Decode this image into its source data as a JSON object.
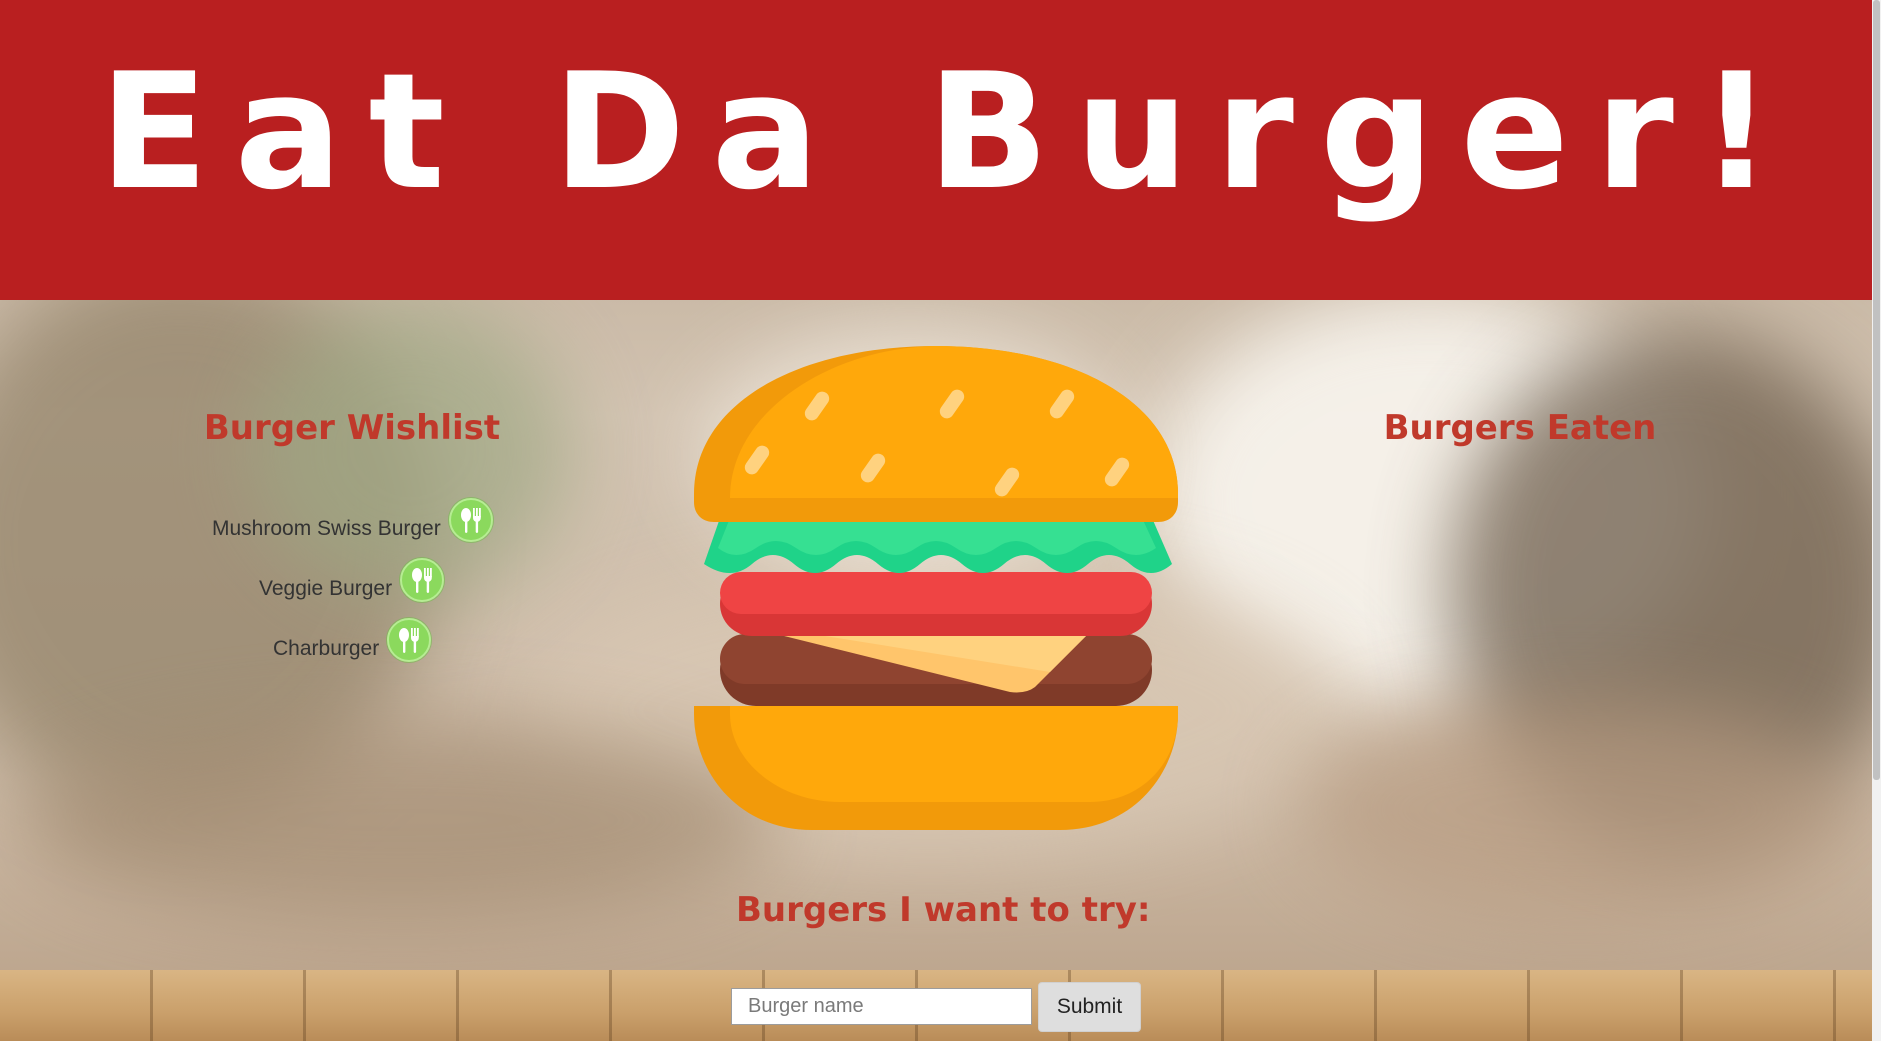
{
  "header": {
    "title": "Eat Da Burger!"
  },
  "wishlist": {
    "heading": "Burger Wishlist",
    "items": [
      {
        "name": "Mushroom Swiss Burger",
        "action_icon": "fork-knife-icon"
      },
      {
        "name": "Veggie Burger",
        "action_icon": "fork-knife-icon"
      },
      {
        "name": "Charburger",
        "action_icon": "fork-knife-icon"
      }
    ]
  },
  "eaten": {
    "heading": "Burgers Eaten",
    "items": []
  },
  "illustration": {
    "icon": "burger-icon"
  },
  "form": {
    "heading": "Burgers I want to try:",
    "input_placeholder": "Burger name",
    "input_value": "",
    "submit_label": "Submit"
  },
  "colors": {
    "header_bg": "#b91f20",
    "heading_text": "#c0392b",
    "devour_button": "#8bd95d",
    "bun": "#ffa80b",
    "lettuce": "#2fdc8c",
    "tomato": "#ef4444",
    "patty": "#8f4430",
    "cheese": "#ffd27f"
  }
}
